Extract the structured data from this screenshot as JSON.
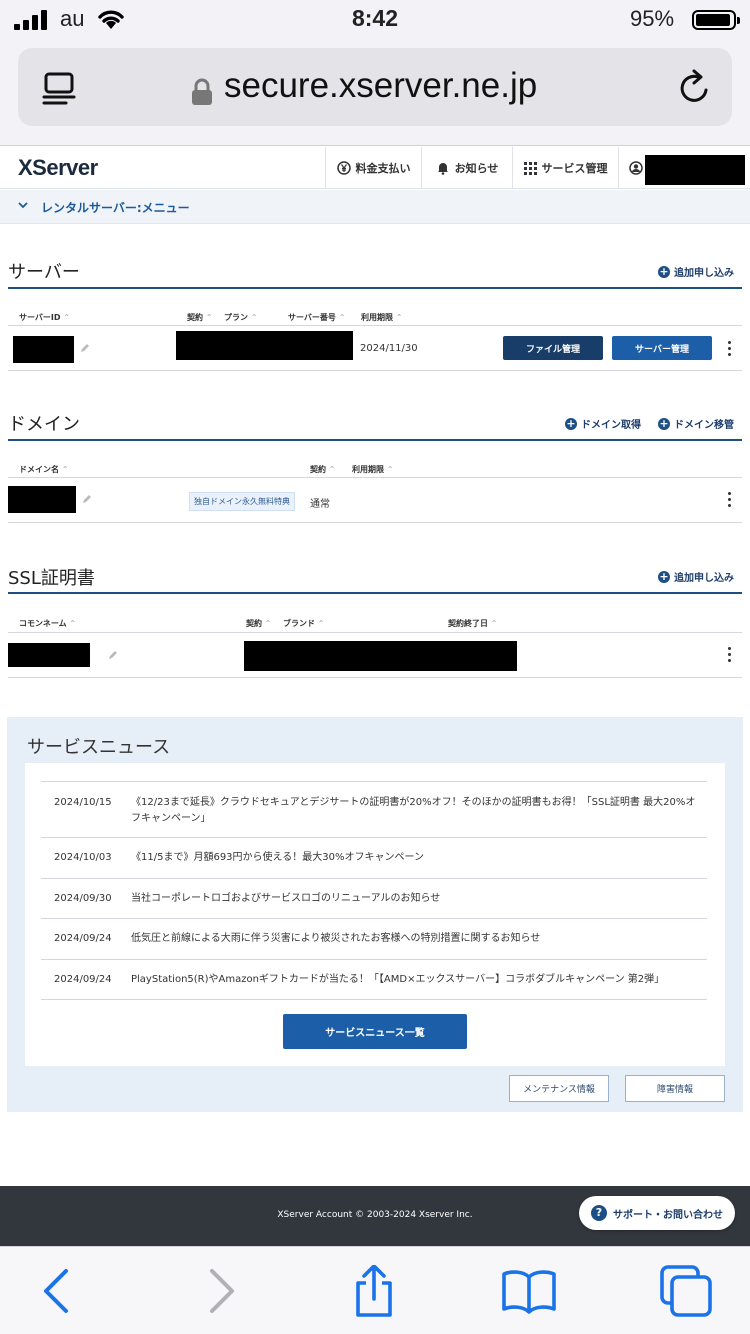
{
  "status": {
    "carrier": "au",
    "time": "8:42",
    "battery": "95%"
  },
  "browser": {
    "url": "secure.xserver.ne.jp"
  },
  "header": {
    "logo": "XServer",
    "nav": [
      {
        "label": "料金支払い",
        "icon": "yen-icon"
      },
      {
        "label": "お知らせ",
        "icon": "bell-icon"
      },
      {
        "label": "サービス管理",
        "icon": "grid-icon"
      }
    ]
  },
  "submenu": {
    "label": "レンタルサーバー:メニュー"
  },
  "server": {
    "title": "サーバー",
    "add_label": "追加申し込み",
    "cols": [
      "サーバーID",
      "契約",
      "プラン",
      "サーバー番号",
      "利用期限"
    ],
    "row": {
      "expiry": "2024/11/30",
      "btn_files": "ファイル管理",
      "btn_server": "サーバー管理"
    }
  },
  "domain": {
    "title": "ドメイン",
    "get_label": "ドメイン取得",
    "move_label": "ドメイン移管",
    "cols": [
      "ドメイン名",
      "契約",
      "利用期限"
    ],
    "row": {
      "badge": "独自ドメイン永久無料特典",
      "contract": "通常"
    }
  },
  "ssl": {
    "title": "SSL証明書",
    "add_label": "追加申し込み",
    "cols": [
      "コモンネーム",
      "契約",
      "ブランド",
      "契約終了日"
    ]
  },
  "news": {
    "title": "サービスニュース",
    "items": [
      {
        "date": "2024/10/15",
        "text": "《12/23まで延長》クラウドセキュアとデジサートの証明書が20%オフ！そのほかの証明書もお得！「SSL証明書 最大20%オフキャンペーン」"
      },
      {
        "date": "2024/10/03",
        "text": "《11/5まで》月額693円から使える！最大30%オフキャンペーン"
      },
      {
        "date": "2024/09/30",
        "text": "当社コーポレートロゴおよびサービスロゴのリニューアルのお知らせ"
      },
      {
        "date": "2024/09/24",
        "text": "低気圧と前線による大雨に伴う災害により被災されたお客様への特別措置に関するお知らせ"
      },
      {
        "date": "2024/09/24",
        "text": "PlayStation5(R)やAmazonギフトカードが当たる！「【AMD×エックスサーバー】コラボダブルキャンペーン 第2弾」"
      }
    ],
    "list_button": "サービスニュース一覧",
    "maintenance": "メンテナンス情報",
    "incident": "障害情報"
  },
  "footer": {
    "copyright": "XServer Account © 2003-2024 Xserver Inc.",
    "support": "サポート・お問い合わせ"
  },
  "colors": {
    "primary": "#1d4f85",
    "button_dark": "#173d68",
    "button": "#1d5ea8",
    "news_bg": "#e6eef8",
    "footer_bg": "#32373d",
    "ios_blue": "#1a73e8"
  }
}
